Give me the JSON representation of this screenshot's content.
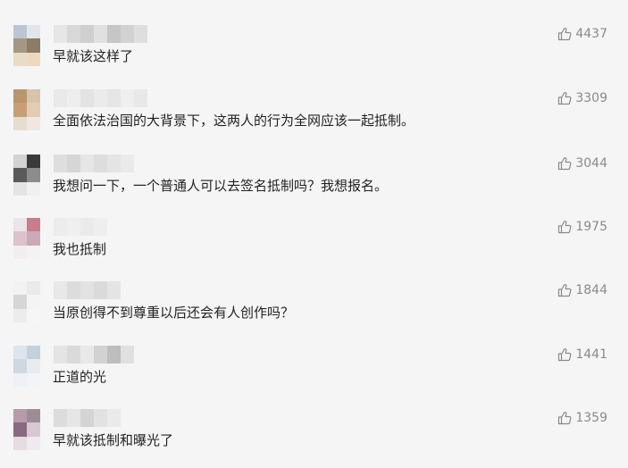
{
  "comments": [
    {
      "text": "早就该这样了",
      "likes": "4437",
      "avatar_colors": [
        "#bcc6d3",
        "#e2e5ea",
        "#a49884",
        "#8c7c66",
        "#e8dcc8",
        "#edd8c0"
      ],
      "name_colors": [
        "#e6e6e6",
        "#d8d8d8",
        "#cfcfcf",
        "#e0e0e0",
        "#c6c6c6",
        "#d2d2d2",
        "#dedede"
      ]
    },
    {
      "text": "全面依法治国的大背景下，这两人的行为全网应该一起抵制。",
      "likes": "3309",
      "avatar_colors": [
        "#b9956e",
        "#d8c3ad",
        "#c69e77",
        "#e2ccb2",
        "#e8dcd0",
        "#f0e8e0"
      ],
      "name_colors": [
        "#e9e9e9",
        "#eeeeee",
        "#e3e3e3",
        "#ebebeb",
        "#e6e6e6",
        "#efefef",
        "#e8e8e8"
      ]
    },
    {
      "text": "我想问一下，一个普通人可以去签名抵制吗？我想报名。",
      "likes": "3044",
      "avatar_colors": [
        "#d3d3d3",
        "#3a3a3a",
        "#5a5a5a",
        "#8c8c8c",
        "#e4e4e4",
        "#f0f0f0"
      ],
      "name_colors": [
        "#dedede",
        "#d6d6d6",
        "#e6e6e6",
        "#dddddd",
        "#e4e4e4",
        "#eaeaea"
      ]
    },
    {
      "text": "我也抵制",
      "likes": "1975",
      "avatar_colors": [
        "#ece4e8",
        "#c97d8a",
        "#dcc2cc",
        "#c9aab6",
        "#f2eef0",
        "#f6f2f4"
      ],
      "name_colors": [
        "#ececec",
        "#efefef",
        "#eaeaea",
        "#eeeeee"
      ]
    },
    {
      "text": "当原创得不到尊重以后还会有人创作吗？",
      "likes": "1844",
      "avatar_colors": [
        "#f2f2f2",
        "#eaeaea",
        "#d6d6d6",
        "#f4f4f4",
        "#ececec",
        "#f6f6f6"
      ],
      "name_colors": [
        "#e8e8e8",
        "#dcdcdc",
        "#e2e2e2",
        "#dadada",
        "#e4e4e4"
      ]
    },
    {
      "text": "正道的光",
      "likes": "1441",
      "avatar_colors": [
        "#dce4ec",
        "#c3d1dd",
        "#cfd7df",
        "#e6ecf0",
        "#eef2f4",
        "#f2f4f6"
      ],
      "name_colors": [
        "#e4e4e4",
        "#dadada",
        "#e8e8e8",
        "#d2d2d2",
        "#bdbdbd",
        "#e0e0e0"
      ]
    },
    {
      "text": "早就该抵制和曝光了",
      "likes": "1359",
      "avatar_colors": [
        "#b59ca8",
        "#9c8c96",
        "#8a6a80",
        "#d8c8d2",
        "#e6dce2",
        "#f0eaee"
      ],
      "name_colors": [
        "#dcdcdc",
        "#e6e6e6",
        "#d4d4d4",
        "#e2e2e2",
        "#eaeaea"
      ]
    }
  ],
  "icons": {
    "like": "thumbs-up-icon"
  },
  "colors": {
    "background": "#f5f5f5",
    "like_text": "#8a8a8a",
    "comment_text": "#222222"
  }
}
